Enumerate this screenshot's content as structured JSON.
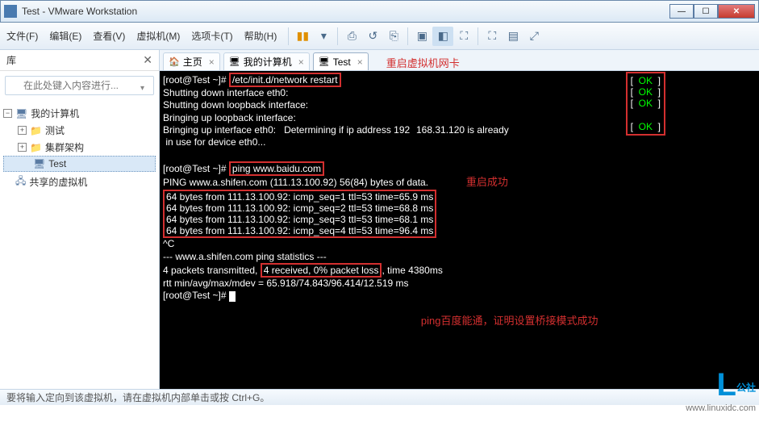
{
  "window": {
    "title": "Test - VMware Workstation"
  },
  "menu": {
    "file": "文件(F)",
    "edit": "编辑(E)",
    "view": "查看(V)",
    "vm": "虚拟机(M)",
    "tabs": "选项卡(T)",
    "help": "帮助(H)"
  },
  "sidebar": {
    "header": "库",
    "search_placeholder": "在此处键入内容进行...",
    "tree": {
      "root": "我的计算机",
      "items": [
        {
          "label": "测试"
        },
        {
          "label": "集群架构"
        },
        {
          "label": "Test"
        }
      ],
      "shared": "共享的虚拟机"
    }
  },
  "tabs": {
    "home": "主页",
    "computer": "我的计算机",
    "test": "Test"
  },
  "annotations": {
    "top": "重启虚拟机网卡",
    "ok_success": "重启成功",
    "bottom": "ping百度能通，证明设置桥接模式成功"
  },
  "terminal": {
    "prompt1": "[root@Test ~]# ",
    "cmd1": "/etc/init.d/network restart",
    "line2a": "Shutting down interface eth0:",
    "line3a": "Shutting down loopback interface:",
    "line4a": "Bringing up loopback interface:",
    "line5a": "Bringing up interface eth0:   Determining if ip address 192",
    "line5b": "168.31.120 is already",
    "line5c": " in use for device eth0...",
    "ok_rows": [
      "[  OK  ]",
      "[  OK  ]",
      "[  OK  ]",
      "",
      "[  OK  ]"
    ],
    "blank": "",
    "prompt2": "[root@Test ~]# ",
    "cmd2": "ping www.baidu.com",
    "ping_hdr": "PING www.a.shifen.com (111.13.100.92) 56(84) bytes of data.",
    "ping_rows": [
      "64 bytes from 111.13.100.92: icmp_seq=1 ttl=53 time=65.9 ms",
      "64 bytes from 111.13.100.92: icmp_seq=2 ttl=53 time=68.8 ms",
      "64 bytes from 111.13.100.92: icmp_seq=3 ttl=53 time=68.1 ms",
      "64 bytes from 111.13.100.92: icmp_seq=4 ttl=53 time=96.4 ms"
    ],
    "sigint": "^C",
    "stats_hdr": "--- www.a.shifen.com ping statistics ---",
    "stats_1a": "4 packets transmitted, ",
    "stats_1b": "4 received, 0% packet loss",
    "stats_1c": ", time 4380ms",
    "stats_2": "rtt min/avg/max/mdev = 65.918/74.843/96.414/12.519 ms",
    "prompt3": "[root@Test ~]# "
  },
  "status": {
    "text": "要将输入定向到该虚拟机，请在虚拟机内部单击或按 Ctrl+G。"
  },
  "watermark": {
    "brand": "公社",
    "url": "www.linuxidc.com"
  }
}
